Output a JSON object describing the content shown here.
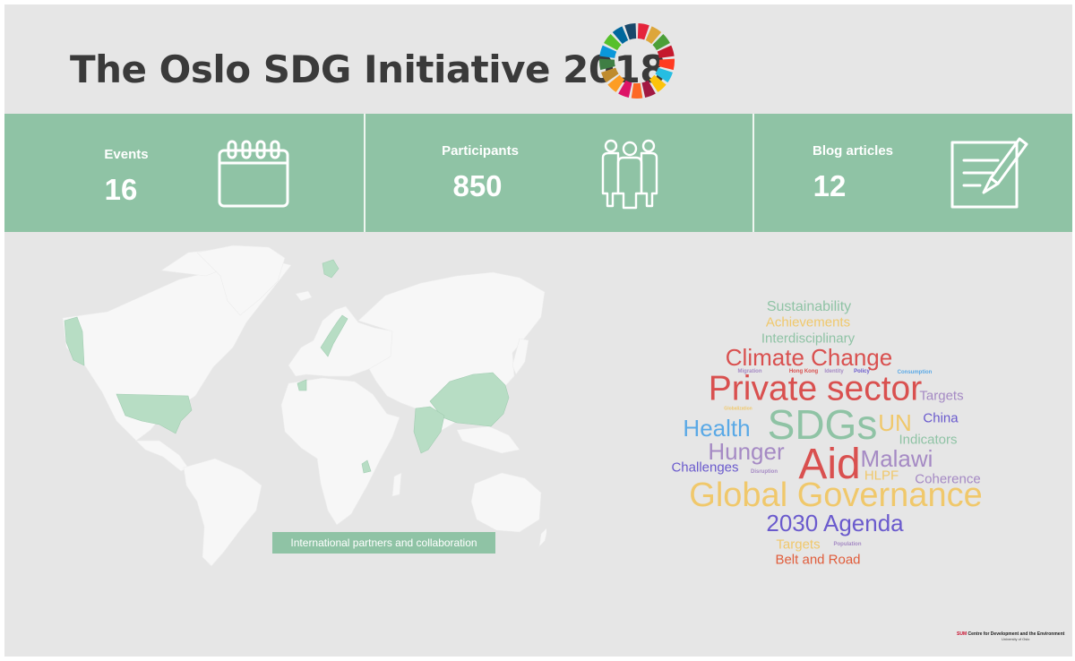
{
  "title": "The Oslo SDG Initiative 2018",
  "sdg_colors": [
    "#e5243b",
    "#dda63a",
    "#4c9f38",
    "#c5192d",
    "#ff3a21",
    "#26bde2",
    "#fcc30b",
    "#a21942",
    "#fd6925",
    "#dd1367",
    "#fd9d24",
    "#bf8b2e",
    "#3f7e44",
    "#0a97d9",
    "#56c02b",
    "#00689d",
    "#19486a"
  ],
  "stats": [
    {
      "label": "Events",
      "value": "16",
      "icon": "calendar-icon"
    },
    {
      "label": "Participants",
      "value": "850",
      "icon": "people-icon"
    },
    {
      "label": "Blog articles",
      "value": "12",
      "icon": "document-edit-icon"
    }
  ],
  "map": {
    "caption": "International partners and collaboration",
    "land_color": "#f7f7f7",
    "highlight_color": "#b7ddc4",
    "highlighted": [
      "Alaska",
      "United States",
      "Greenland",
      "Norway",
      "Malawi",
      "China",
      "India",
      "Svalbard"
    ]
  },
  "word_cloud": [
    {
      "text": "Sustainability",
      "color": "#8fc3a5"
    },
    {
      "text": "Achievements",
      "color": "#f0c86b"
    },
    {
      "text": "Interdisciplinary",
      "color": "#8fc3a5"
    },
    {
      "text": "Climate Change",
      "color": "#d9504f"
    },
    {
      "text": "Migration",
      "color": "#a58ac4"
    },
    {
      "text": "Hong Kong",
      "color": "#d9504f"
    },
    {
      "text": "Identity",
      "color": "#a58ac4"
    },
    {
      "text": "Policy",
      "color": "#6a5acd"
    },
    {
      "text": "Consumption",
      "color": "#5aa9e6"
    },
    {
      "text": "Private sector",
      "color": "#d9504f"
    },
    {
      "text": "Targets",
      "color": "#a58ac4"
    },
    {
      "text": "Globalization",
      "color": "#f0c86b"
    },
    {
      "text": "Health",
      "color": "#5aa9e6"
    },
    {
      "text": "SDGs",
      "color": "#8fc3a5"
    },
    {
      "text": "UN",
      "color": "#f0c86b"
    },
    {
      "text": "China",
      "color": "#6a5acd"
    },
    {
      "text": "Indicators",
      "color": "#8fc3a5"
    },
    {
      "text": "Hunger",
      "color": "#a58ac4"
    },
    {
      "text": "Aid",
      "color": "#d9504f"
    },
    {
      "text": "Malawi",
      "color": "#a58ac4"
    },
    {
      "text": "Challenges",
      "color": "#6a5acd"
    },
    {
      "text": "Disruption",
      "color": "#a58ac4"
    },
    {
      "text": "HLPF",
      "color": "#f0c86b"
    },
    {
      "text": "Coherence",
      "color": "#a58ac4"
    },
    {
      "text": "Global Governance",
      "color": "#f0c86b"
    },
    {
      "text": "2030 Agenda",
      "color": "#6a5acd"
    },
    {
      "text": "Targets",
      "color": "#f0c86b"
    },
    {
      "text": "Population",
      "color": "#a58ac4"
    },
    {
      "text": "Belt and Road",
      "color": "#e05c3a"
    }
  ],
  "footer": {
    "org_prefix": "SUM",
    "org_name": "Centre for Development and the Environment",
    "university": "University of Oslo"
  }
}
